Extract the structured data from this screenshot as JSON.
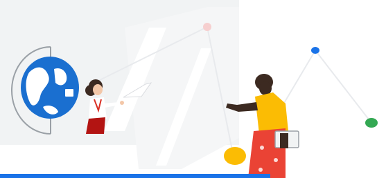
{
  "hero": {
    "colors": {
      "blue": "#1a73e8",
      "globe_blue": "#1a6fd0",
      "red": "#d93025",
      "yellow": "#fbbc04",
      "green": "#34a853",
      "pink": "#f6cfcf",
      "panel": "#f1f3f4",
      "skin": "#3c2a21"
    },
    "icons": [
      "globe-icon",
      "tablet-icon"
    ]
  }
}
